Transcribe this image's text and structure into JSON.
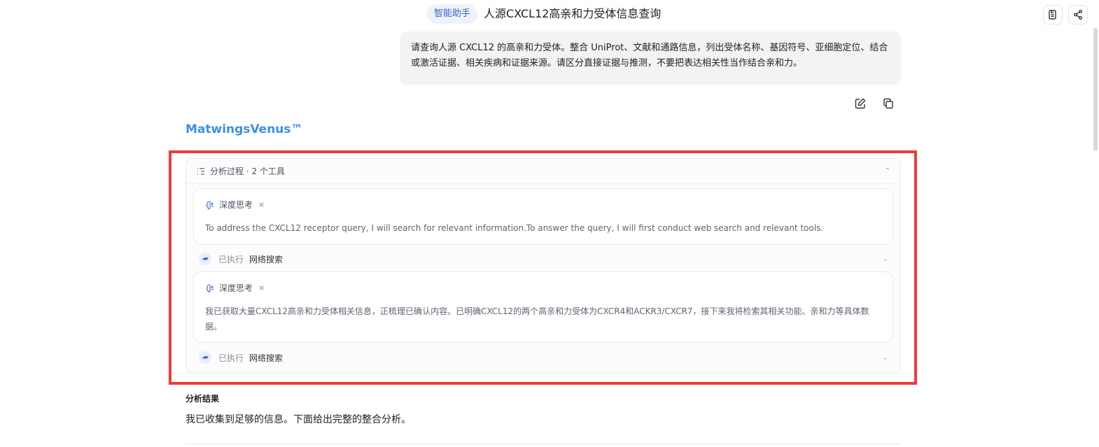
{
  "header": {
    "badge": "智能助手",
    "title": "人源CXCL12高亲和力受体信息查询",
    "buttons": [
      {
        "icon": "document-icon"
      },
      {
        "icon": "share-icon"
      }
    ]
  },
  "user_message": {
    "text": "请查询人源 CXCL12 的高亲和力受体。整合 UniProt、文献和通路信息，列出受体名称、基因符号、亚细胞定位、结合或激活证据、相关疾病和证据来源。请区分直接证据与推测，不要把表达相关性当作结合亲和力。",
    "actions": [
      {
        "icon": "edit-icon"
      },
      {
        "icon": "copy-icon"
      }
    ]
  },
  "assistant": {
    "brand": "MatwingsVenus™",
    "analysis": {
      "header_label": "分析过程 · 2 个工具",
      "steps": [
        {
          "type": "think",
          "label": "深度思考",
          "text": "To address the CXCL12 receptor query, I will search for relevant information.To answer the query, I will first conduct web search and relevant tools."
        },
        {
          "type": "tool",
          "state": "已执行",
          "tool": "网络搜索"
        },
        {
          "type": "think",
          "label": "深度思考",
          "text": "我已获取大量CXCL12高亲和力受体相关信息，正梳理已确认内容。已明确CXCL12的两个高亲和力受体为CXCR4和ACKR3/CXCR7，接下来我将检索其相关功能、亲和力等具体数据。"
        },
        {
          "type": "tool",
          "state": "已执行",
          "tool": "网络搜索"
        }
      ]
    },
    "result_title": "分析结果",
    "result_text": "我已收集到足够的信息。下面给出完整的整合分析。"
  },
  "colors": {
    "brand": "#3d8fe6",
    "highlight": "#ee3b3b",
    "badge_bg": "#eef2fb",
    "badge_fg": "#3b63c4"
  }
}
